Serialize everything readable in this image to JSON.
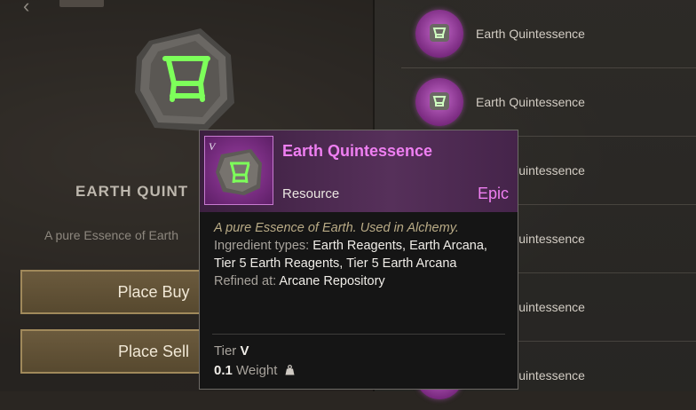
{
  "left_panel": {
    "item_title": "EARTH QUINT",
    "item_description": "A pure Essence of Earth",
    "place_buy_label": "Place Buy",
    "place_sell_label": "Place Sell"
  },
  "listings": [
    {
      "name": "Earth Quintessence"
    },
    {
      "name": "Earth Quintessence"
    },
    {
      "name": "Earth Quintessence"
    },
    {
      "name": "Earth Quintessence"
    },
    {
      "name": "Earth Quintessence"
    },
    {
      "name": "Earth Quintessence"
    }
  ],
  "tooltip": {
    "tier_mark": "V",
    "name": "Earth Quintessence",
    "type": "Resource",
    "rarity": "Epic",
    "flavor": "A pure Essence of Earth. Used in Alchemy.",
    "ingredient_label": "Ingredient types:",
    "ingredient_value": "Earth Reagents, Earth Arcana, Tier 5 Earth Reagents, Tier 5 Earth Arcana",
    "refined_label": "Refined at:",
    "refined_value": "Arcane Repository",
    "tier_label": "Tier",
    "tier_value": "V",
    "weight_value": "0.1",
    "weight_label": "Weight"
  },
  "colors": {
    "epic": "#ef7ff2",
    "rune_green": "#7dff5a",
    "button_border": "#a0895b"
  },
  "icons": {
    "item": "earth-quintessence-stone-icon",
    "weight": "weight-icon",
    "back": "back-arrow-icon"
  }
}
